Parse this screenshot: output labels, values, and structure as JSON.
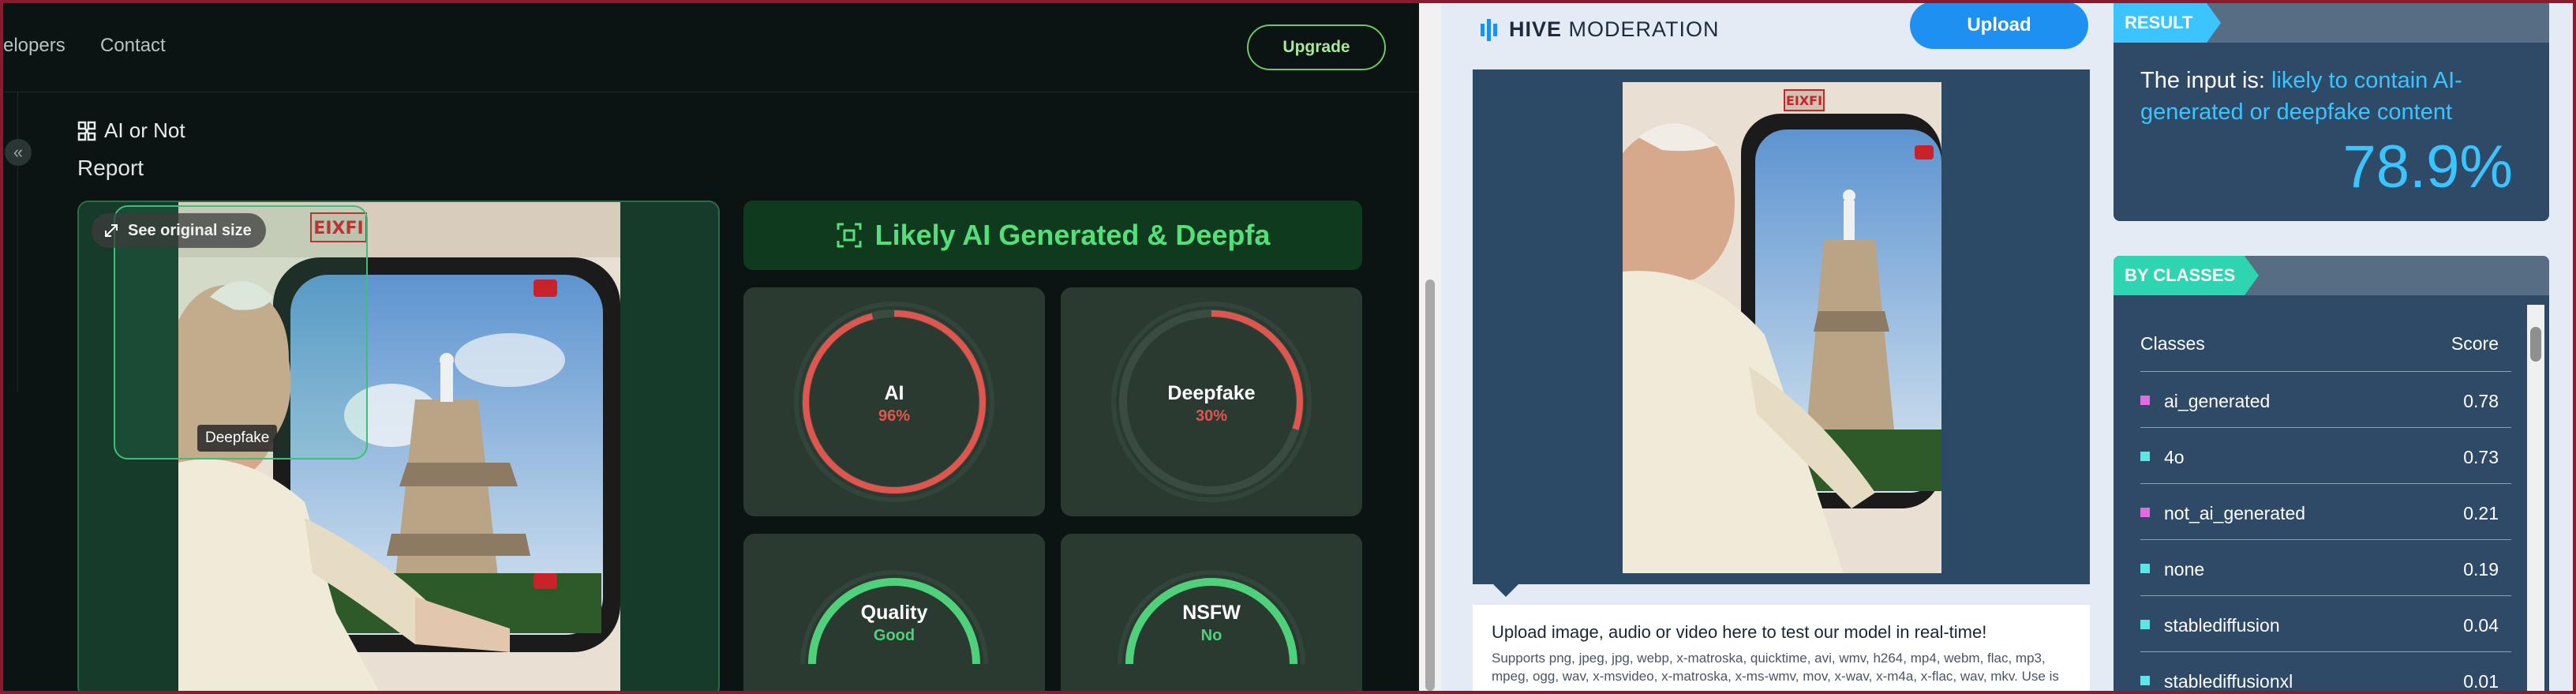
{
  "left": {
    "nav": {
      "developers": "elopers",
      "contact": "Contact"
    },
    "upgrade_label": "Upgrade",
    "brand": "AI or Not",
    "report_label": "Report",
    "see_original": "See original size",
    "detection_tag": "Deepfake",
    "verdict": "Likely AI Generated & Deepfa",
    "gauges": [
      {
        "title": "AI",
        "value": "96%",
        "fill": 0.96,
        "color": "#e0564f"
      },
      {
        "title": "Deepfake",
        "value": "30%",
        "fill": 0.3,
        "color": "#e0564f"
      },
      {
        "title": "Quality",
        "value": "Good",
        "fill": 1.0,
        "color": "#4fd07a"
      },
      {
        "title": "NSFW",
        "value": "No",
        "fill": 1.0,
        "color": "#4fd07a"
      }
    ],
    "sign_text": "EIXFI"
  },
  "right": {
    "logo_hive": "HIVE",
    "logo_moderation": "MODERATION",
    "upload_label": "Upload",
    "upload_title": "Upload image, audio or video here to test our model in real-time!",
    "upload_sub": "Supports png, jpeg, jpg, webp, x-matroska, quicktime, avi, wmv, h264, mp4, webm, flac, mp3, mpeg, ogg, wav, x-msvideo, x-matroska, x-ms-wmv, mov, x-wav, x-m4a, x-flac, wav, mkv. Use is",
    "result_tag": "RESULT",
    "result_prefix": "The input is: ",
    "result_highlight": "likely to contain AI-generated or deepfake content",
    "result_score": "78.9%",
    "classes_tag": "BY CLASSES",
    "col_classes": "Classes",
    "col_score": "Score",
    "rows": [
      {
        "name": "ai_generated",
        "score": "0.78",
        "color": "#e36be0"
      },
      {
        "name": "4o",
        "score": "0.73",
        "color": "#5ee6e6"
      },
      {
        "name": "not_ai_generated",
        "score": "0.21",
        "color": "#e36be0"
      },
      {
        "name": "none",
        "score": "0.19",
        "color": "#5ee6e6"
      },
      {
        "name": "stablediffusion",
        "score": "0.04",
        "color": "#5ee6e6"
      },
      {
        "name": "stablediffusionxl",
        "score": "0.01",
        "color": "#5ee6e6"
      }
    ]
  },
  "colors": {
    "accent_green": "#53e07a",
    "accent_blue": "#3bc4ff",
    "hive_button": "#1e90f2"
  }
}
